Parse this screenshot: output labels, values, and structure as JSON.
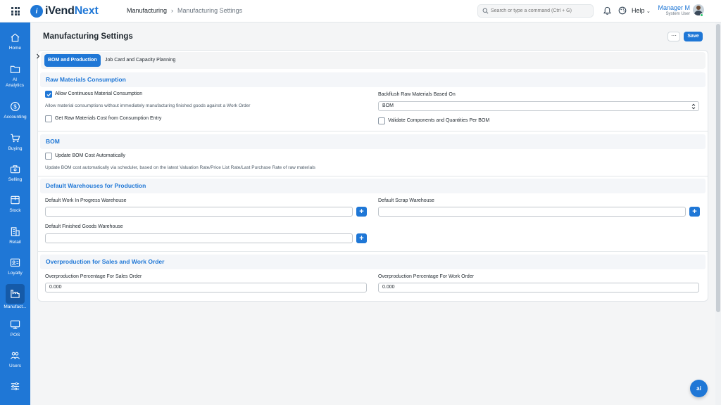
{
  "app": {
    "logo_prefix": "iVend",
    "logo_suffix": "Next",
    "logo_mark": "i"
  },
  "header": {
    "breadcrumb": [
      "Manufacturing",
      "Manufacturing Settings"
    ],
    "search_placeholder": "Search or type a command (Ctrl + G)",
    "help_label": "Help",
    "user_name": "Manager M",
    "user_role": "System User"
  },
  "sidebar": {
    "items": [
      {
        "label": "Home",
        "icon": "home-icon"
      },
      {
        "label": "AI Analytics",
        "icon": "folder-icon"
      },
      {
        "label": "Accounting",
        "icon": "dollar-icon"
      },
      {
        "label": "Buying",
        "icon": "cart-icon"
      },
      {
        "label": "Selling",
        "icon": "briefcase-icon"
      },
      {
        "label": "Stock",
        "icon": "box-icon"
      },
      {
        "label": "Retail",
        "icon": "building-icon"
      },
      {
        "label": "Loyalty",
        "icon": "id-card-icon"
      },
      {
        "label": "Manufact...",
        "icon": "factory-icon"
      },
      {
        "label": "POS",
        "icon": "monitor-icon"
      },
      {
        "label": "Users",
        "icon": "users-icon"
      },
      {
        "label": "",
        "icon": "sliders-icon"
      }
    ]
  },
  "page": {
    "title": "Manufacturing Settings",
    "more_label": "···",
    "save_label": "Save"
  },
  "tabs": [
    "BOM and Production",
    "Job Card and Capacity Planning"
  ],
  "sections": {
    "raw": {
      "title": "Raw Materials Consumption",
      "allow_continuous_label": "Allow Continuous Material Consumption",
      "allow_continuous_checked": true,
      "allow_continuous_desc": "Allow material consumptions without immediately manufacturing finished goods against a Work Order",
      "get_cost_label": "Get Raw Materials Cost from Consumption Entry",
      "get_cost_checked": false,
      "backflush_label": "Backflush Raw Materials Based On",
      "backflush_value": "BOM",
      "validate_label": "Validate Components and Quantities Per BOM",
      "validate_checked": false
    },
    "bom": {
      "title": "BOM",
      "update_cost_label": "Update BOM Cost Automatically",
      "update_cost_checked": false,
      "update_cost_desc": "Update BOM cost automatically via scheduler, based on the latest Valuation Rate/Price List Rate/Last Purchase Rate of raw materials"
    },
    "warehouses": {
      "title": "Default Warehouses for Production",
      "wip_label": "Default Work In Progress Warehouse",
      "wip_value": "",
      "scrap_label": "Default Scrap Warehouse",
      "scrap_value": "",
      "finished_label": "Default Finished Goods Warehouse",
      "finished_value": "",
      "add_label": "+"
    },
    "overproduction": {
      "title": "Overproduction for Sales and Work Order",
      "sales_label": "Overproduction Percentage For Sales Order",
      "sales_value": "0.000",
      "work_label": "Overproduction Percentage For Work Order",
      "work_value": "0.000"
    }
  },
  "ai_button_label": "ai",
  "colors": {
    "brand": "#1f77d6",
    "sidebar_active": "#155aa8",
    "section_title": "#1f77d6"
  }
}
